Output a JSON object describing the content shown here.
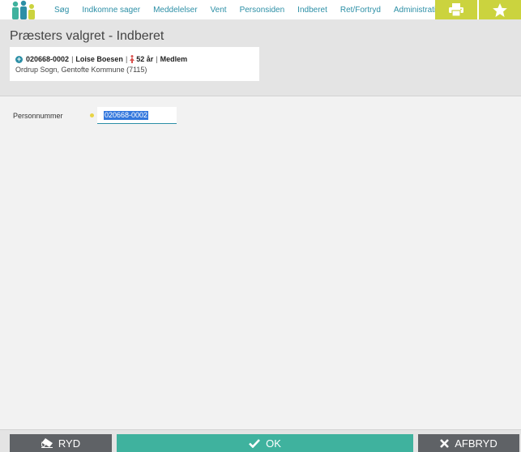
{
  "nav": {
    "items": [
      {
        "label": "Søg"
      },
      {
        "label": "Indkomne sager"
      },
      {
        "label": "Meddelelser"
      },
      {
        "label": "Vent"
      },
      {
        "label": "Personsiden"
      },
      {
        "label": "Indberet"
      },
      {
        "label": "Ret/Fortryd"
      },
      {
        "label": "Administration"
      }
    ],
    "icons": [
      "print-icon",
      "star-icon"
    ]
  },
  "page": {
    "title": "Præsters valgret - Indberet"
  },
  "person": {
    "cpr": "020668-0002",
    "name": "Loise Boesen",
    "age": "52 år",
    "status": "Medlem",
    "sep": "|",
    "location": "Ordrup Sogn, Gentofte Kommune (7115)"
  },
  "form": {
    "personnummer_label": "Personnummer",
    "personnummer_value": "020668-0002"
  },
  "buttons": {
    "ryd": "RYD",
    "ok": "OK",
    "afbryd": "AFBRYD"
  },
  "colors": {
    "accent": "#2c8fa6",
    "toolbar": "#cbd33e",
    "ok": "#3fb29e",
    "secondary": "#5f6266"
  }
}
